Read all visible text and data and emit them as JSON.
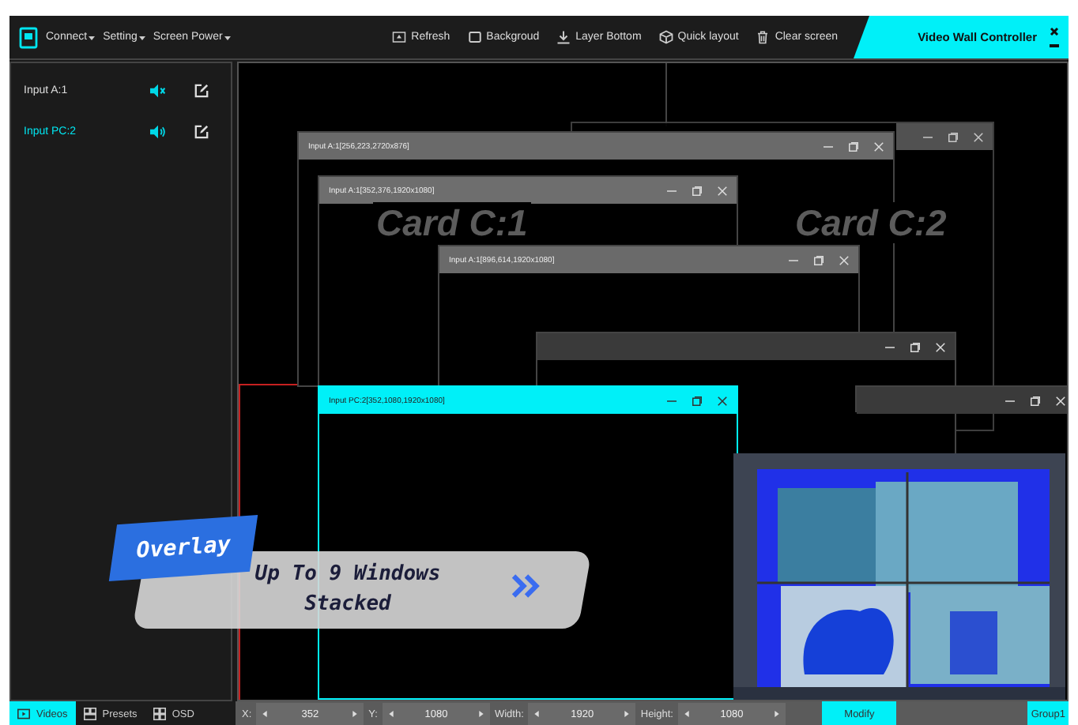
{
  "menu": [
    {
      "label": "Connect"
    },
    {
      "label": "Setting"
    },
    {
      "label": "Screen Power"
    }
  ],
  "toolbar": [
    {
      "kind": "refresh",
      "label": "Refresh"
    },
    {
      "kind": "background",
      "label": "Backgroud"
    },
    {
      "kind": "layer",
      "label": "Layer Bottom"
    },
    {
      "kind": "layout",
      "label": "Quick layout"
    },
    {
      "kind": "clear",
      "label": "Clear screen"
    }
  ],
  "window": {
    "title": "Video Wall Controller"
  },
  "inputs": [
    {
      "name": "Input A:1",
      "muted": true,
      "selected": false
    },
    {
      "name": "Input PC:2",
      "muted": false,
      "selected": true
    }
  ],
  "card_labels": [
    "Card C:1",
    "Card C:2"
  ],
  "windows": [
    {
      "selected": false
    },
    {
      "title": "Input A:1[256,223,2720x876]",
      "selected": false
    },
    {
      "title": "Input A:1[352,376,1920x1080]",
      "selected": false
    },
    {
      "title": "Input A:1[896,614,1920x1080]",
      "selected": false
    },
    {
      "selected": false
    },
    {
      "selected": false
    },
    {
      "title": "Input PC:2[352,1080,1920x1080]",
      "selected": true
    }
  ],
  "overlay": {
    "tag": "Overlay",
    "text": "Up To 9 Windows Stacked"
  },
  "bottom_tabs": [
    {
      "label": "Videos",
      "selected": true
    },
    {
      "label": "Presets",
      "selected": false
    },
    {
      "label": "OSD",
      "selected": false
    }
  ],
  "fields": [
    {
      "label": "X:",
      "value": "352"
    },
    {
      "label": "Y:",
      "value": "1080"
    },
    {
      "label": "Width:",
      "value": "1920"
    },
    {
      "label": "Height:",
      "value": "1080"
    }
  ],
  "buttons": [
    {
      "label": "Modify"
    },
    {
      "label": "Group1"
    }
  ]
}
